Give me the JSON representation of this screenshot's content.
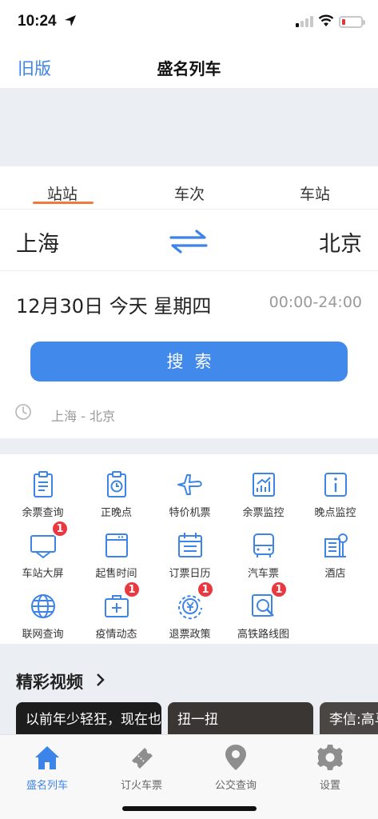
{
  "status_bar": {
    "time": "10:24"
  },
  "nav": {
    "back_label": "旧版",
    "title": "盛名列车"
  },
  "search": {
    "tabs": [
      {
        "label": "站站",
        "active": true
      },
      {
        "label": "车次",
        "active": false
      },
      {
        "label": "车站",
        "active": false
      }
    ],
    "from_city": "上海",
    "to_city": "北京",
    "date_text": "12月30日 今天 星期四",
    "time_range": "00:00-24:00",
    "search_button": "搜索",
    "history": "上海 - 北京"
  },
  "features": [
    {
      "label": "余票查询",
      "icon": "clipboard-icon",
      "badge": null
    },
    {
      "label": "正晚点",
      "icon": "clock-board-icon",
      "badge": null
    },
    {
      "label": "特价机票",
      "icon": "airplane-icon",
      "badge": null
    },
    {
      "label": "余票监控",
      "icon": "chart-monitor-icon",
      "badge": null
    },
    {
      "label": "晚点监控",
      "icon": "info-icon",
      "badge": null
    },
    {
      "label": "车站大屏",
      "icon": "screen-icon",
      "badge": "1"
    },
    {
      "label": "起售时间",
      "icon": "oven-icon",
      "badge": null
    },
    {
      "label": "订票日历",
      "icon": "calendar-icon",
      "badge": null
    },
    {
      "label": "汽车票",
      "icon": "bus-icon",
      "badge": null
    },
    {
      "label": "酒店",
      "icon": "hotel-icon",
      "badge": null
    },
    {
      "label": "联网查询",
      "icon": "globe-icon",
      "badge": null
    },
    {
      "label": "疫情动态",
      "icon": "medical-kit-icon",
      "badge": "1"
    },
    {
      "label": "退票政策",
      "icon": "yen-refund-icon",
      "badge": "1"
    },
    {
      "label": "高铁路线图",
      "icon": "map-search-icon",
      "badge": "1"
    }
  ],
  "videos": {
    "title": "精彩视频",
    "items": [
      {
        "caption": "以前年少轻狂，现在也是狂，只是"
      },
      {
        "caption": "扭一扭"
      },
      {
        "caption": "李信:高马尾，宝贝"
      }
    ]
  },
  "tab_bar": [
    {
      "label": "盛名列车",
      "icon": "home-icon",
      "active": true
    },
    {
      "label": "订火车票",
      "icon": "ticket-icon",
      "active": false
    },
    {
      "label": "公交查询",
      "icon": "location-pin-icon",
      "active": false
    },
    {
      "label": "设置",
      "icon": "gear-icon",
      "active": false
    }
  ],
  "colors": {
    "accent": "#3d84e8",
    "button": "#4289ec",
    "tab_underline": "#f07a3b",
    "badge": "#e9383f"
  }
}
